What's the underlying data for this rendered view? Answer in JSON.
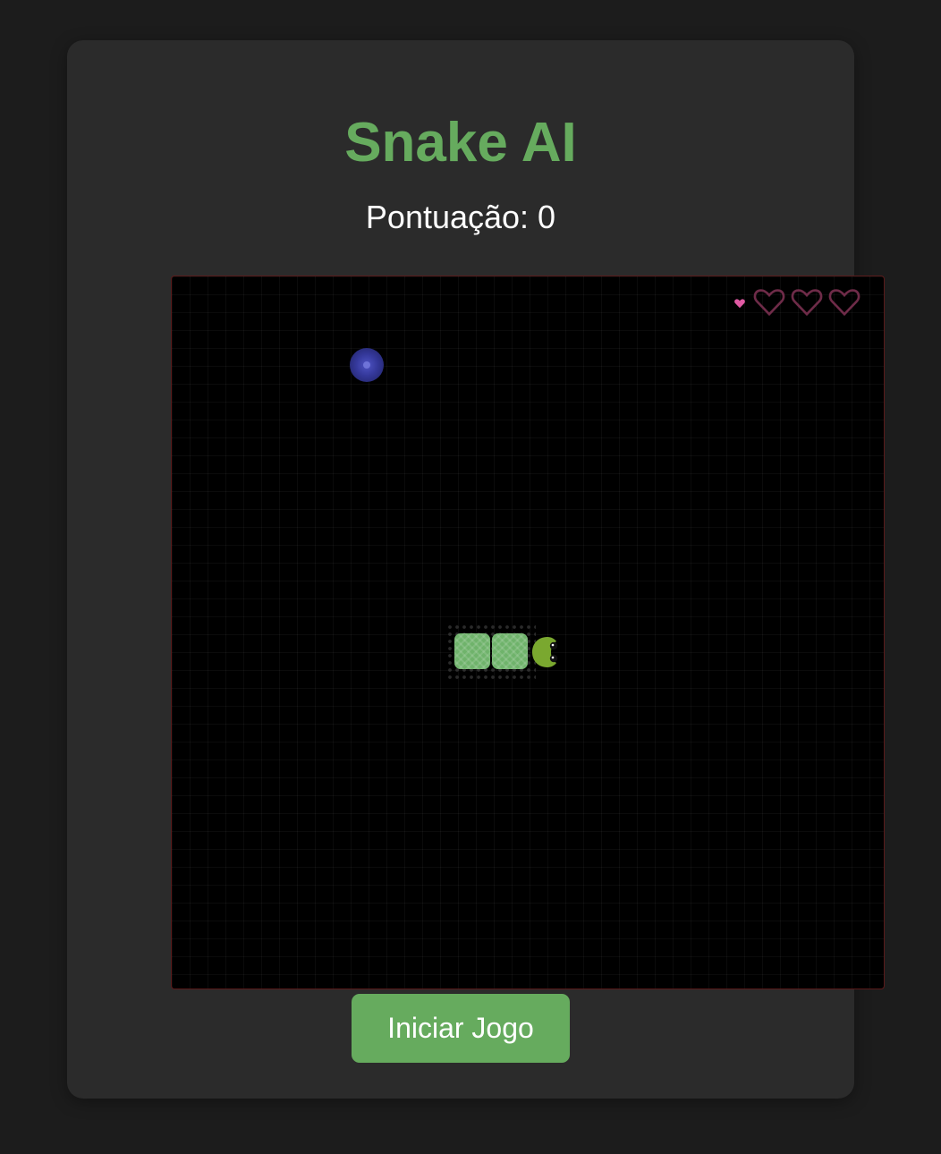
{
  "title": "Snake AI",
  "score": {
    "label": "Pontuação: 0",
    "value": 0
  },
  "board": {
    "lives_total": 3,
    "lives_filled": 0,
    "life_indicator": "heart-icon",
    "food": "blue-orb",
    "snake_length": 3,
    "snake_direction": "right"
  },
  "start_button": {
    "label": "Iniciar Jogo"
  },
  "colors": {
    "accent": "#66ab5e",
    "background": "#1c1c1c",
    "card": "#2b2b2b",
    "board": "#000000",
    "heart": "#e05aa3",
    "heart_outline": "#6e2b48",
    "food": "#34389a"
  }
}
